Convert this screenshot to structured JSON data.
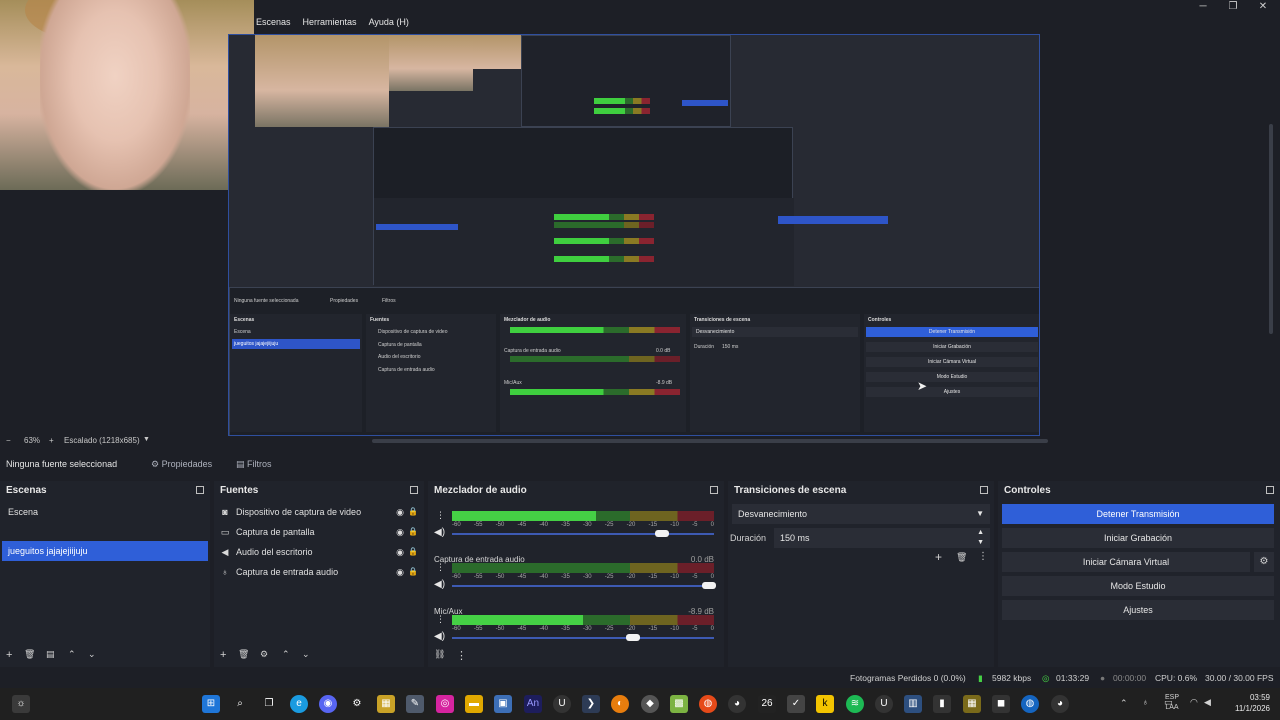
{
  "menu": [
    "Escenas",
    "Herramientas",
    "Ayuda (H)"
  ],
  "window_controls": {
    "minimize": "─",
    "maximize": "❐",
    "close": "✕"
  },
  "preview_mini": {
    "no_source": "Ninguna fuente seleccionada",
    "properties": "Propiedades",
    "filters": "Filtros",
    "scenes_title": "Escenas",
    "sources_title": "Fuentes",
    "mixer_title": "Mezclador de audio",
    "transitions_title": "Transiciones de escena",
    "controls_title": "Controles",
    "scenes": [
      "Escena",
      "jueguitos jajajejiijuju"
    ],
    "sources": [
      "Dispositivo de captura de video",
      "Captura de pantalla",
      "Audio del escritorio",
      "Captura de entrada audio"
    ],
    "mixer_channels": [
      "Captura de entrada audio",
      "Mic/Aux"
    ],
    "mixer_db": [
      "0.0 dB",
      "-8.9 dB"
    ],
    "transition": "Desvanecimiento",
    "duration_label": "Duración",
    "duration_value": "150 ms",
    "controls": [
      "Detener Transmisión",
      "Iniciar Grabación",
      "Iniciar Cámara Virtual",
      "Modo Estudio",
      "Ajustes"
    ],
    "zoom": "63%",
    "scaled": "Escalado (1218x685)"
  },
  "zoom_bar": {
    "minus": "−",
    "zoom": "63%",
    "plus": "+",
    "scaled": "Escalado (1218x685)"
  },
  "source_toolbar": {
    "no_source": "Ninguna fuente seleccionad",
    "properties": "Propiedades",
    "filters": "Filtros"
  },
  "scenes": {
    "title": "Escenas",
    "items": [
      "Escena",
      "jueguitos jajajejiijuju"
    ],
    "selected_index": 1
  },
  "sources": {
    "title": "Fuentes",
    "items": [
      {
        "label": "Dispositivo de captura de video",
        "icon": "camera-icon"
      },
      {
        "label": "Captura de pantalla",
        "icon": "monitor-icon"
      },
      {
        "label": "Audio del escritorio",
        "icon": "speaker-icon"
      },
      {
        "label": "Captura de entrada audio",
        "icon": "microphone-icon"
      }
    ]
  },
  "mixer": {
    "title": "Mezclador de audio",
    "ticks": [
      "-60",
      "-55",
      "-50",
      "-45",
      "-40",
      "-35",
      "-30",
      "-25",
      "-20",
      "-15",
      "-10",
      "-5",
      "0"
    ],
    "channels": [
      {
        "name": "",
        "db": "",
        "level": 0.55,
        "volume": 0.8
      },
      {
        "name": "Captura de entrada audio",
        "db": "0.0 dB",
        "level": 0.0,
        "volume": 0.98
      },
      {
        "name": "Mic/Aux",
        "db": "-8.9 dB",
        "level": 0.5,
        "volume": 0.69
      }
    ]
  },
  "transitions": {
    "title": "Transiciones de escena",
    "selected": "Desvanecimiento",
    "duration_label": "Duración",
    "duration_value": "150 ms"
  },
  "controls": {
    "title": "Controles",
    "stop_stream": "Detener Transmisión",
    "start_recording": "Iniciar Grabación",
    "start_virtual_cam": "Iniciar Cámara Virtual",
    "studio_mode": "Modo Estudio",
    "settings": "Ajustes"
  },
  "status": {
    "dropped": "Fotogramas Perdidos 0 (0.0%)",
    "bitrate": "5982 kbps",
    "stream_time": "01:33:29",
    "rec_time": "00:00:00",
    "cpu": "CPU: 0.6%",
    "fps": "30.00 / 30.00 FPS"
  },
  "tray": {
    "lang_top": "ESP",
    "lang_bottom": "LAA",
    "time": "03:59",
    "date": "11/1/2026"
  },
  "taskbar_counter": "26",
  "colors": {
    "accent": "#2f5fd8",
    "bg": "#1d1f26",
    "panel": "#20232b",
    "meter_green": "#45d045"
  }
}
